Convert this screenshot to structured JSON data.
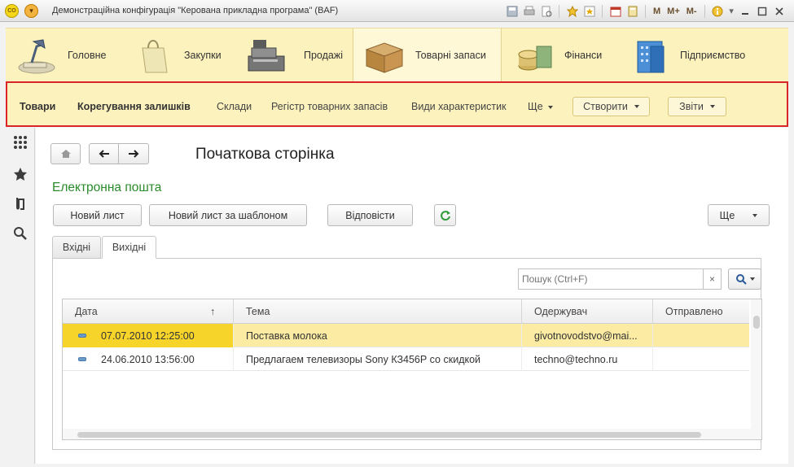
{
  "window": {
    "title": "Демонстраційна конфігурація \"Керована прикладна програма\"  (BAF)",
    "logo_text": "CO",
    "tools": [
      "M",
      "M+",
      "M-"
    ]
  },
  "sections": [
    {
      "label": "Головне",
      "icon": "desk-lamp-icon",
      "active": false
    },
    {
      "label": "Закупки",
      "icon": "shopping-bag-icon",
      "active": false
    },
    {
      "label": "Продажі",
      "icon": "cash-register-icon",
      "active": false
    },
    {
      "label": "Товарні запаси",
      "icon": "box-icon",
      "active": true
    },
    {
      "label": "Фінанси",
      "icon": "coins-icon",
      "active": false
    },
    {
      "label": "Підприємство",
      "icon": "building-icon",
      "active": false
    }
  ],
  "navpanel": {
    "items": [
      "Товари",
      "Корегування залишків",
      "Склади",
      "Регістр товарних запасів",
      "Види характеристик"
    ],
    "more": "Ще",
    "create": "Створити",
    "reports": "Звіти"
  },
  "content": {
    "page_title": "Початкова сторінка",
    "form_title": "Електронна пошта",
    "buttons": {
      "new_letter": "Новий лист",
      "new_from_template": "Новий лист за шаблоном",
      "reply": "Відповісти",
      "more": "Ще"
    },
    "tabs": [
      {
        "label": "Вхідні",
        "active": false
      },
      {
        "label": "Вихідні",
        "active": true
      }
    ],
    "search": {
      "placeholder": "Пошук (Ctrl+F)",
      "clear": "×"
    },
    "table": {
      "columns": [
        "Дата",
        "Тема",
        "Одержувач",
        "Отправлено"
      ],
      "sort_indicator": "↑",
      "rows": [
        {
          "date": "07.07.2010 12:25:00",
          "subject": "Поставка молока",
          "recipient": "givotnovodstvo@mai...",
          "sent": "",
          "selected": true
        },
        {
          "date": "24.06.2010 13:56:00",
          "subject": "Предлагаем телевизоры Sony КЗ456Р со скидкой",
          "recipient": "techno@techno.ru",
          "sent": "",
          "selected": false
        }
      ]
    }
  },
  "colors": {
    "sections_bg": "#fcf2bd",
    "nav_highlight_border": "#d9252a",
    "form_title": "#2a8b2a",
    "selected_row": "#fbeba3"
  }
}
